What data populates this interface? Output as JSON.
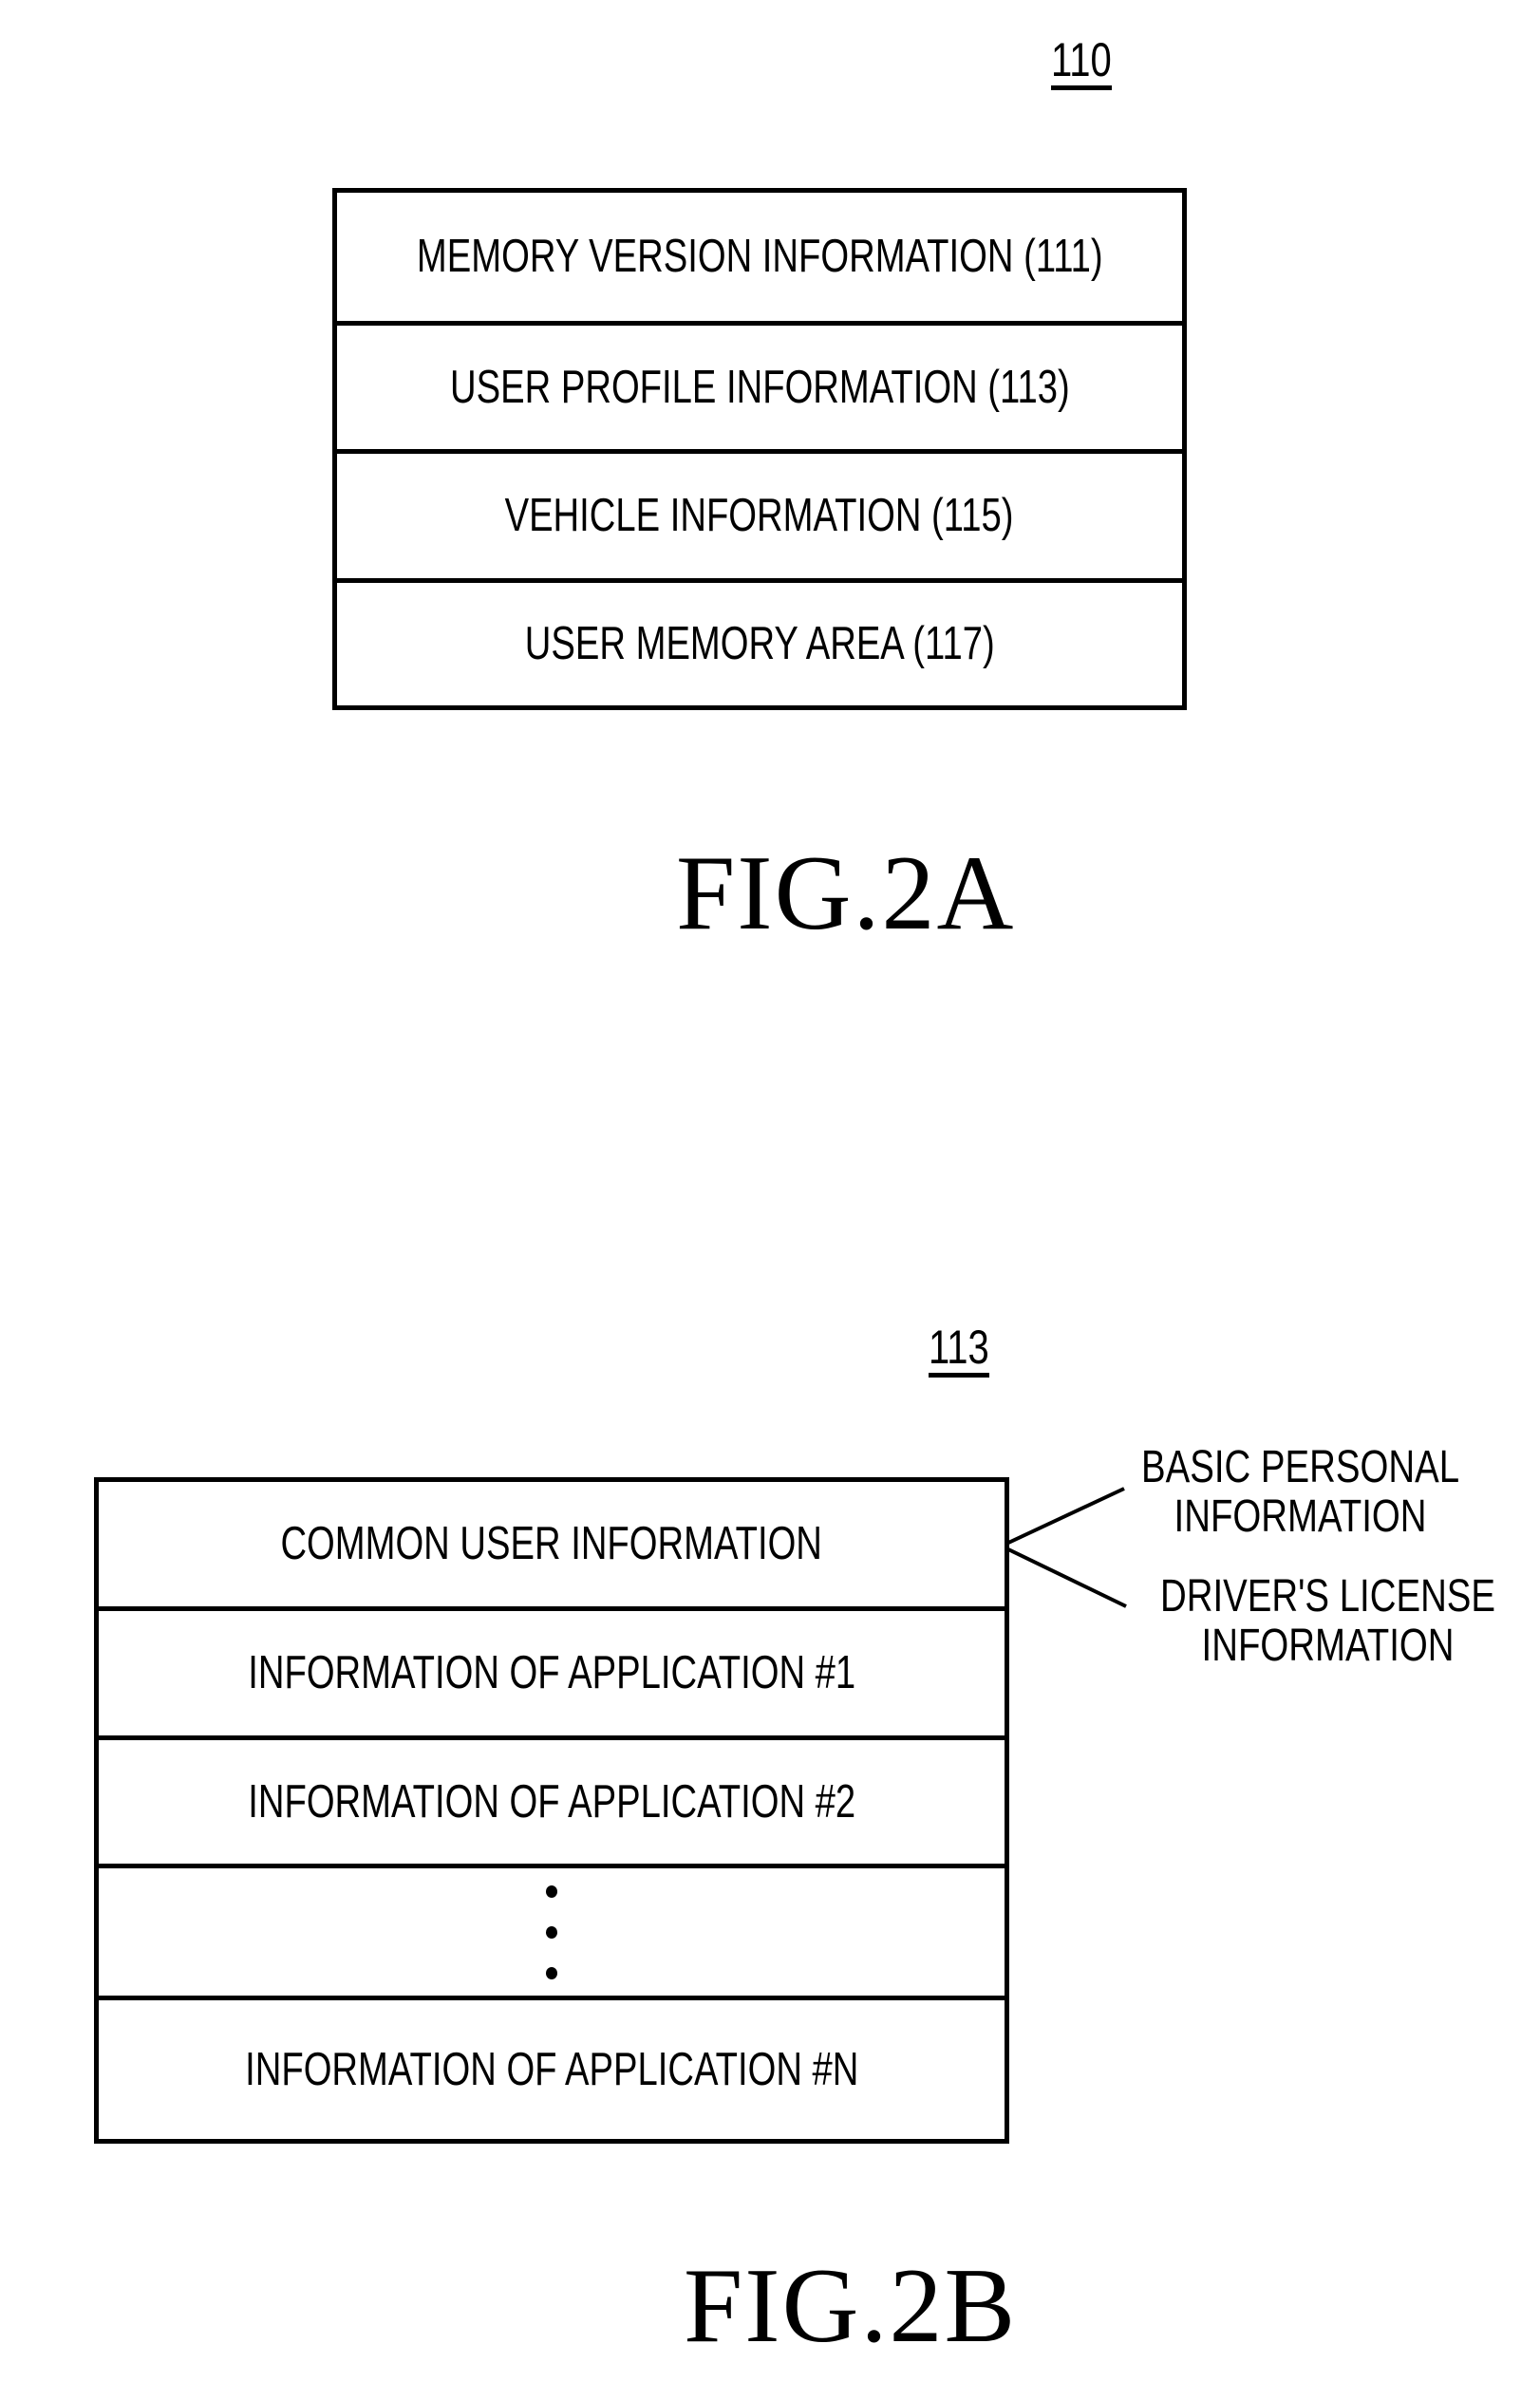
{
  "fig_2a": {
    "reference_numeral": "110",
    "rows": [
      {
        "label": "MEMORY VERSION INFORMATION (111)"
      },
      {
        "label": "USER PROFILE INFORMATION (113)"
      },
      {
        "label": "VEHICLE INFORMATION (115)"
      },
      {
        "label": "USER MEMORY AREA (117)"
      }
    ],
    "title": "FIG.2A"
  },
  "fig_2b": {
    "reference_numeral": "113",
    "rows": [
      {
        "label": "COMMON USER INFORMATION"
      },
      {
        "label": "INFORMATION OF APPLICATION #1"
      },
      {
        "label": "INFORMATION OF APPLICATION #2"
      },
      {
        "label": "",
        "ellipsis": "vertical-dots"
      },
      {
        "label": "INFORMATION OF APPLICATION #N"
      }
    ],
    "callouts": [
      {
        "line1": "BASIC PERSONAL",
        "line2": "INFORMATION"
      },
      {
        "line1": "DRIVER'S LICENSE",
        "line2": "INFORMATION"
      }
    ],
    "title": "FIG.2B"
  }
}
